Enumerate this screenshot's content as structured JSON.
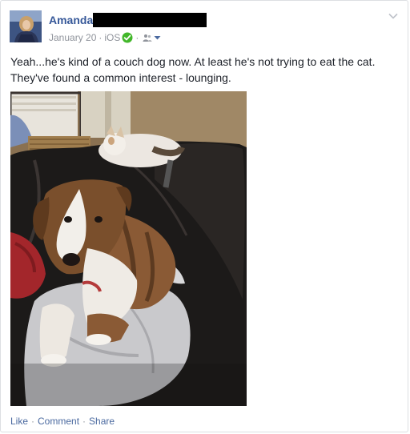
{
  "post": {
    "author": "Amanda",
    "date": "January 20",
    "dot": "·",
    "via": "iOS",
    "text_line1": "Yeah...he's kind of a couch dog now. At least he's not trying to eat the cat.",
    "text_line2": "They've found a common interest - lounging.",
    "icons": {
      "verified": "check-circle-icon",
      "audience": "friends-icon",
      "menu": "chevron-down-icon"
    },
    "colors": {
      "link": "#365899",
      "meta": "#90949c",
      "action": "#4b6aa0",
      "verified": "#42b72a"
    }
  },
  "actions": {
    "like": "Like",
    "comment": "Comment",
    "share": "Share",
    "sep": "·"
  }
}
